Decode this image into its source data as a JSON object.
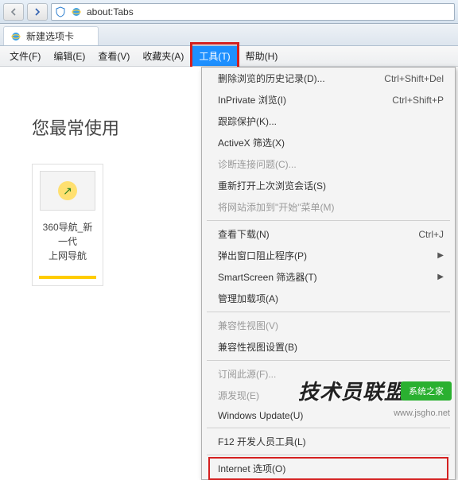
{
  "address_bar": {
    "url": "about:Tabs"
  },
  "tab": {
    "title": "新建选项卡"
  },
  "menubar": {
    "file": "文件(F)",
    "edit": "编辑(E)",
    "view": "查看(V)",
    "favorites": "收藏夹(A)",
    "tools": "工具(T)",
    "help": "帮助(H)"
  },
  "content": {
    "header": "您最常使用",
    "tile_label": "360导航_新一代\n上网导航"
  },
  "tools_menu": {
    "delete_history": {
      "label": "删除浏览的历史记录(D)...",
      "shortcut": "Ctrl+Shift+Del"
    },
    "inprivate": {
      "label": "InPrivate 浏览(I)",
      "shortcut": "Ctrl+Shift+P"
    },
    "tracking": {
      "label": "跟踪保护(K)..."
    },
    "activex": {
      "label": "ActiveX 筛选(X)"
    },
    "diagnose": {
      "label": "诊断连接问题(C)..."
    },
    "reopen": {
      "label": "重新打开上次浏览会话(S)"
    },
    "add_start": {
      "label": "将网站添加到\"开始\"菜单(M)"
    },
    "downloads": {
      "label": "查看下载(N)",
      "shortcut": "Ctrl+J"
    },
    "popup": {
      "label": "弹出窗口阻止程序(P)"
    },
    "smartscreen": {
      "label": "SmartScreen 筛选器(T)"
    },
    "addons": {
      "label": "管理加载项(A)"
    },
    "compat_view": {
      "label": "兼容性视图(V)"
    },
    "compat_settings": {
      "label": "兼容性视图设置(B)"
    },
    "subscribe": {
      "label": "订阅此源(F)..."
    },
    "feed_discovery": {
      "label": "源发现(E)"
    },
    "windows_update": {
      "label": "Windows Update(U)"
    },
    "f12": {
      "label": "F12 开发人员工具(L)"
    },
    "internet_options": {
      "label": "Internet 选项(O)"
    }
  },
  "watermark": {
    "text": "技术员联盟",
    "badge_line1": "系统之家",
    "url": "www.jsgho.net"
  }
}
